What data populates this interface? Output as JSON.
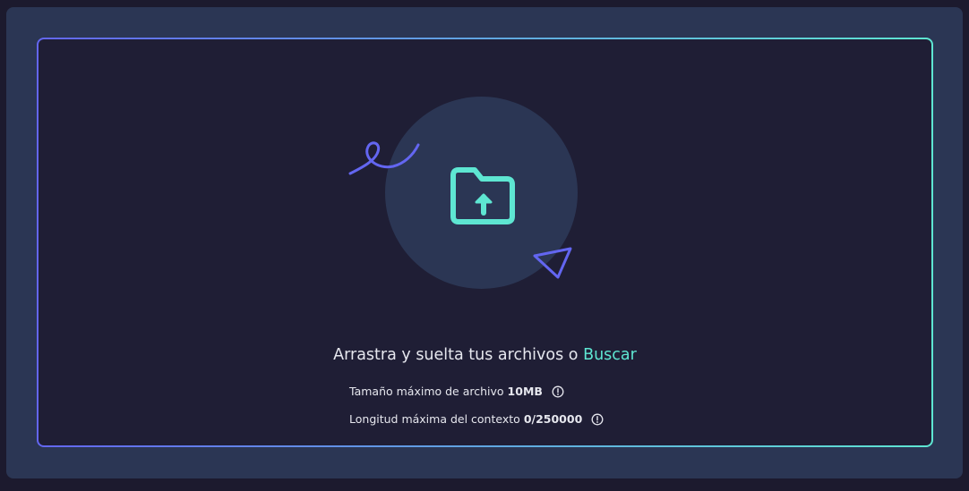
{
  "upload": {
    "headline": "Arrastra y suelta tus archivos o",
    "browse_label": "Buscar",
    "max_file_size": {
      "label": "Tamaño máximo de archivo",
      "value": "10MB"
    },
    "max_context": {
      "label": "Longitud máxima del contexto",
      "value": "0/250000"
    }
  },
  "colors": {
    "accent_teal": "#5ee6d2",
    "accent_indigo": "#6366f1",
    "panel": "#2b3654",
    "dropzone": "#1f1e35"
  },
  "icons": [
    "folder-upload-icon",
    "squiggle-icon",
    "triangle-icon",
    "info-icon"
  ]
}
